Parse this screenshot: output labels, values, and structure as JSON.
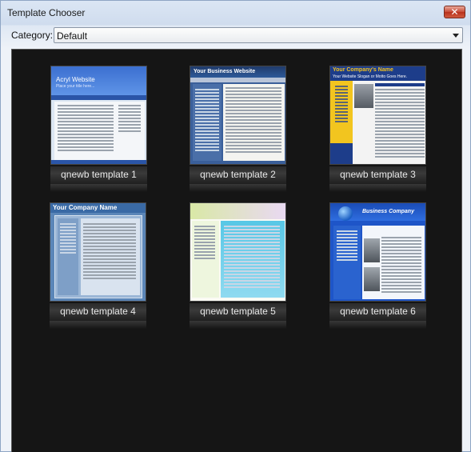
{
  "window": {
    "title": "Template Chooser",
    "close_glyph": "✕"
  },
  "category": {
    "label": "Category:",
    "selected": "Default"
  },
  "templates": [
    {
      "name": "qnewb template 1",
      "preview_title": "Acryl Website",
      "preview_subtitle": "Place your title here...",
      "icon": "template-1-thumbnail"
    },
    {
      "name": "qnewb template 2",
      "preview_title": "Your Business Website",
      "icon": "template-2-thumbnail"
    },
    {
      "name": "qnewb template 3",
      "preview_title": "Your Company's Name",
      "preview_subtitle": "Your Website Slogan or Motto Goes Here.",
      "icon": "template-3-thumbnail"
    },
    {
      "name": "qnewb template 4",
      "preview_title": "Your Company Name",
      "icon": "template-4-thumbnail"
    },
    {
      "name": "qnewb template 5",
      "icon": "template-5-thumbnail"
    },
    {
      "name": "qnewb template 6",
      "preview_title": "Business Company",
      "icon": "template-6-thumbnail"
    }
  ],
  "colors": {
    "gallery_bg": "#151515",
    "caption_text": "#e8e8e8"
  }
}
